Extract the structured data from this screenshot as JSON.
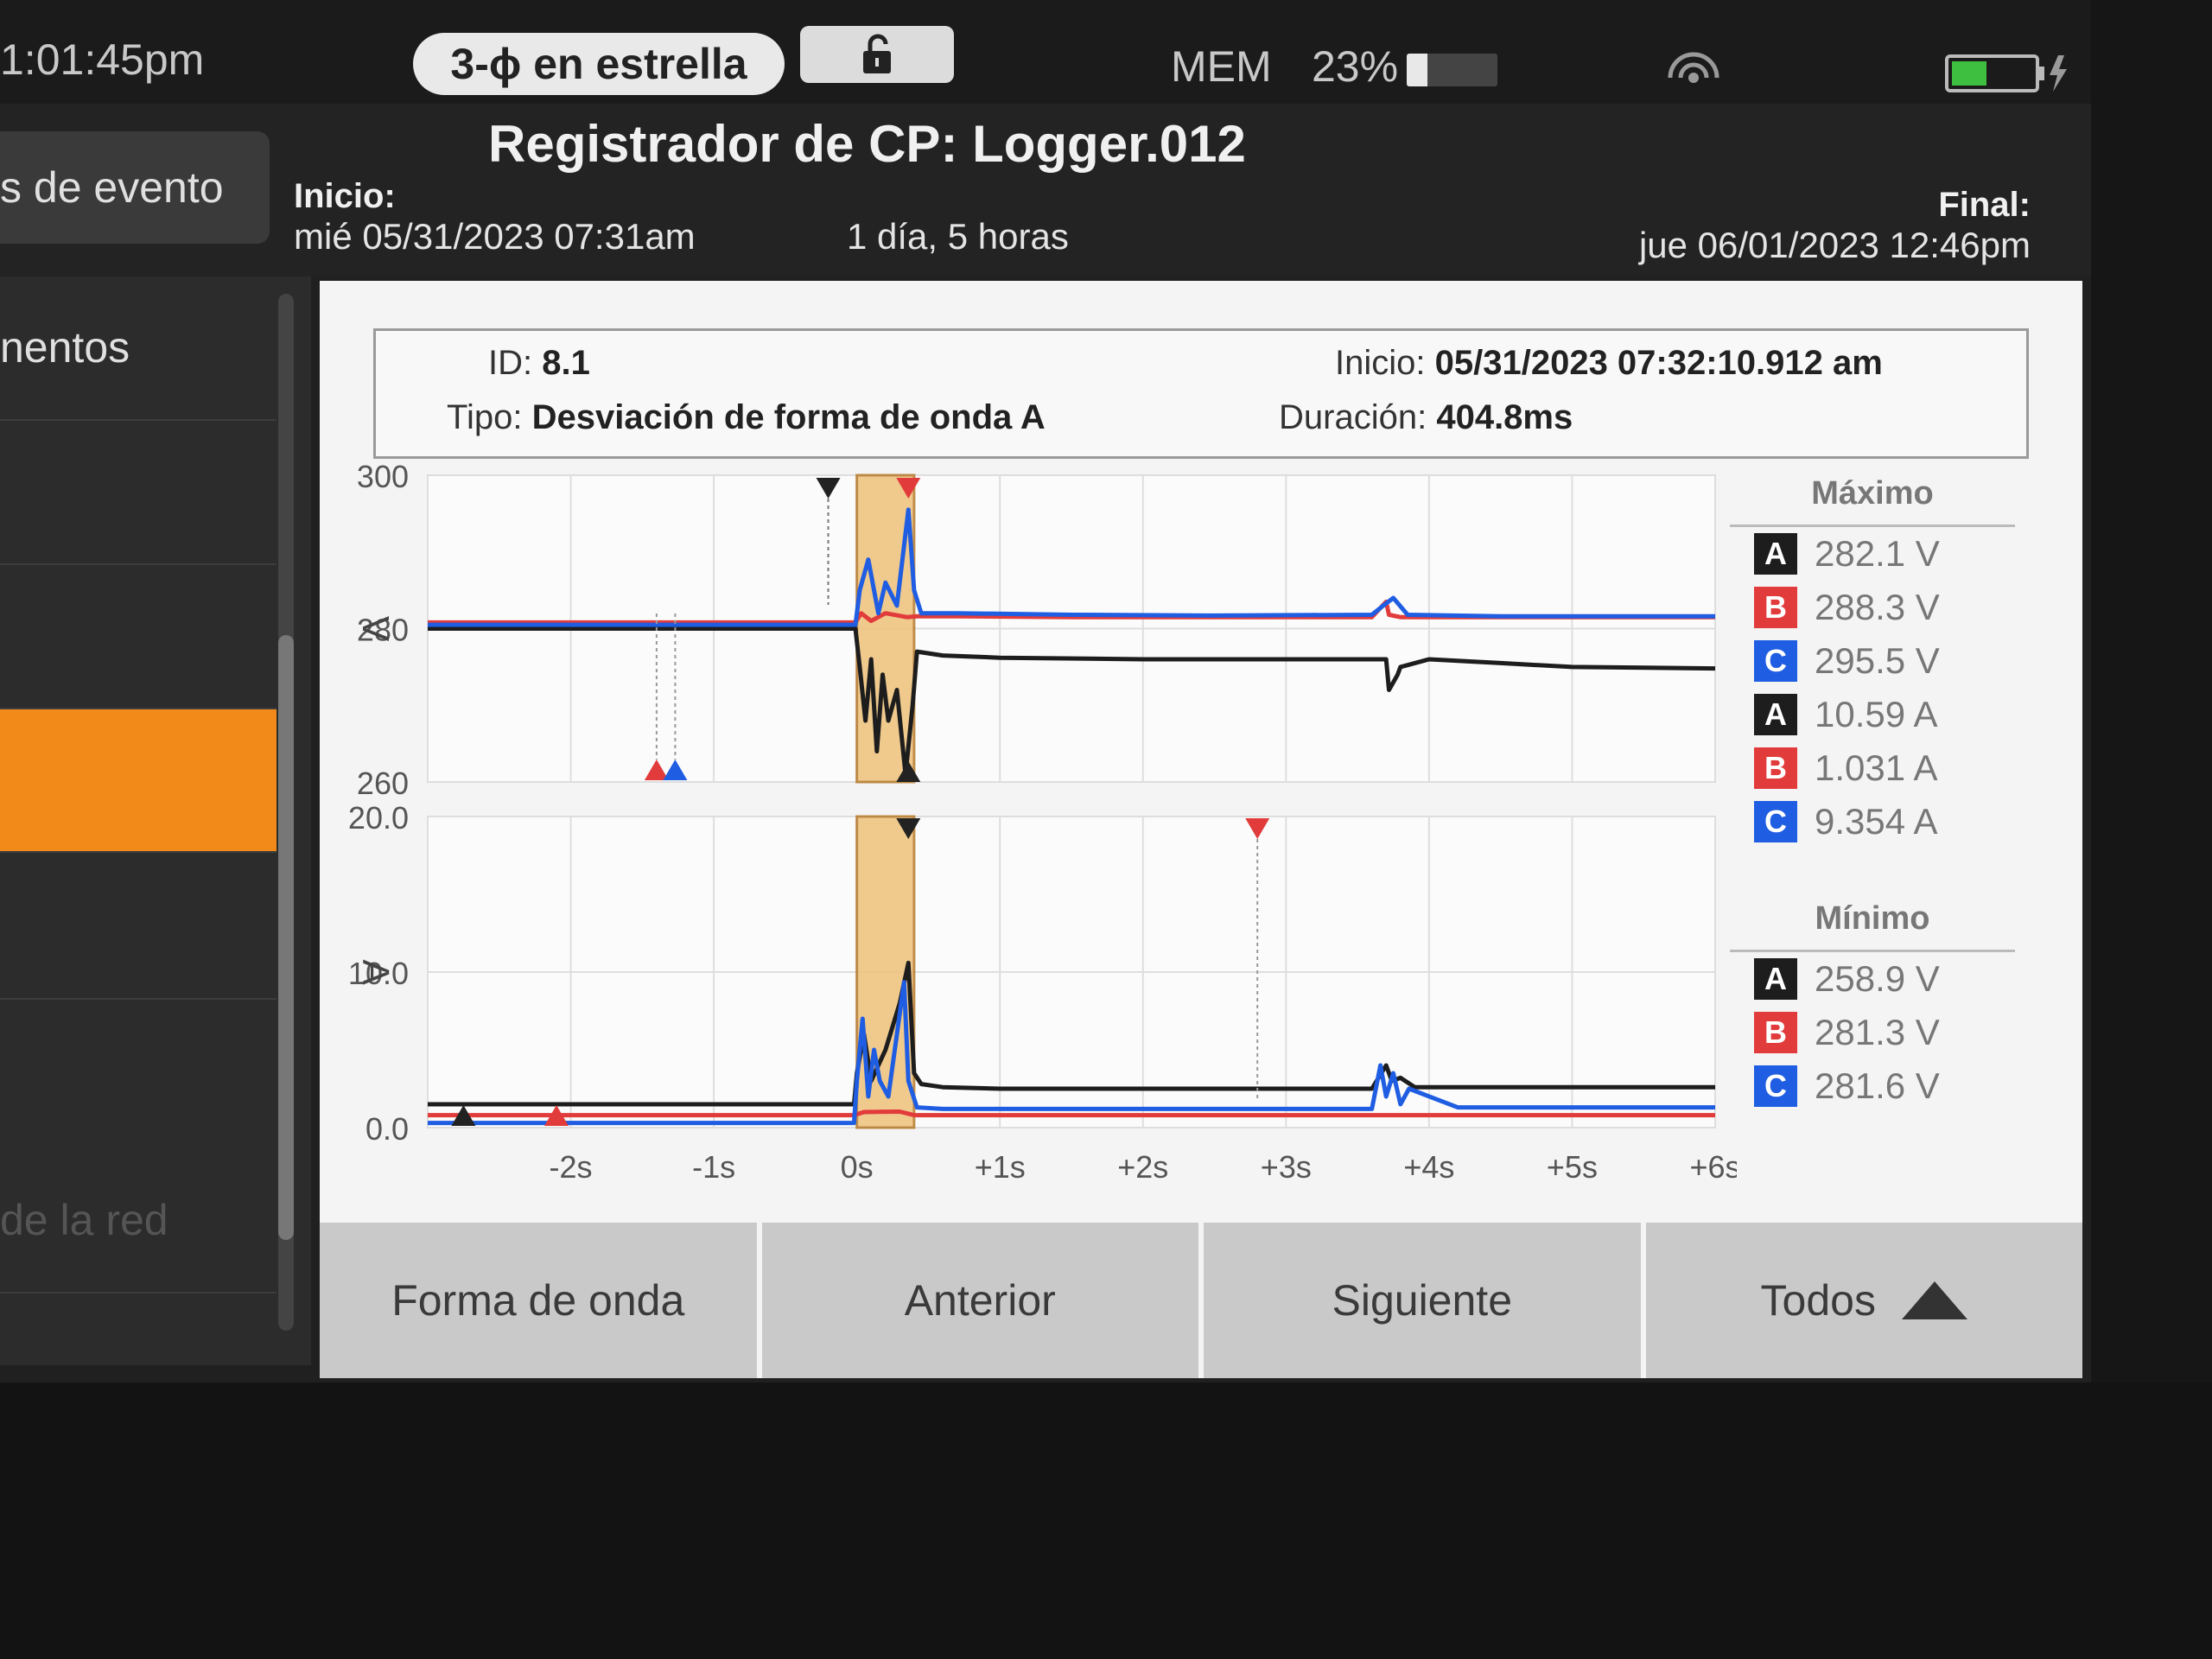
{
  "status": {
    "time": "1:01:45pm",
    "mode": "3-ϕ en estrella",
    "mem_label": "MEM",
    "mem_value": "23%",
    "mem_fraction": 0.23
  },
  "header": {
    "side_tab": "s de evento",
    "title": "Registrador de CP: Logger.012",
    "start_label": "Inicio:",
    "start_value": "mié 05/31/2023 07:31am",
    "duration": "1 día, 5 horas",
    "end_label": "Final:",
    "end_value": "jue 06/01/2023 12:46pm"
  },
  "menu": {
    "items": [
      {
        "label": "nentos"
      },
      {
        "label": ""
      },
      {
        "label": ""
      },
      {
        "label": ""
      },
      {
        "label": ""
      },
      {
        "label": "de la red"
      }
    ]
  },
  "event": {
    "id_label": "ID:",
    "id_value": "8.1",
    "type_label": "Tipo:",
    "type_value": "Desviación de forma de onda A",
    "start_label": "Inicio:",
    "start_value": "05/31/2023 07:32:10.912 am",
    "dur_label": "Duración:",
    "dur_value": "404.8ms"
  },
  "legend": {
    "max_title": "Máximo",
    "max": [
      {
        "phase": "A",
        "value": "282.1 V"
      },
      {
        "phase": "B",
        "value": "288.3 V"
      },
      {
        "phase": "C",
        "value": "295.5 V"
      },
      {
        "phase": "A",
        "value": "10.59 A"
      },
      {
        "phase": "B",
        "value": "1.031 A"
      },
      {
        "phase": "C",
        "value": "9.354 A"
      }
    ],
    "min_title": "Mínimo",
    "min": [
      {
        "phase": "A",
        "value": "258.9 V"
      },
      {
        "phase": "B",
        "value": "281.3 V"
      },
      {
        "phase": "C",
        "value": "281.6 V"
      }
    ]
  },
  "buttons": {
    "waveform": "Forma de onda",
    "prev": "Anterior",
    "next": "Siguiente",
    "all": "Todos"
  },
  "colors": {
    "A": "#1d1d1d",
    "B": "#e23b3b",
    "C": "#1f5de2",
    "event": "#efc27a",
    "active": "#f28a1a"
  },
  "chart_data": [
    {
      "type": "line",
      "ylabel": "V",
      "ylim": [
        260,
        300
      ],
      "yticks": [
        "300",
        "280",
        "260"
      ],
      "xlim": [
        -3,
        6
      ],
      "xticks": [
        "-2s",
        "-1s",
        "0s",
        "+1s",
        "+2s",
        "+3s",
        "+4s",
        "+5s",
        "+6s"
      ],
      "event_window": [
        0,
        0.4
      ],
      "series": [
        {
          "name": "A",
          "x": [
            -3,
            -0.01,
            0.02,
            0.06,
            0.1,
            0.14,
            0.18,
            0.22,
            0.28,
            0.34,
            0.39,
            0.42,
            0.6,
            1,
            2,
            3.5,
            3.7,
            3.72,
            3.78,
            3.8,
            4,
            4.5,
            5,
            6
          ],
          "y": [
            280,
            280,
            275,
            268,
            276,
            264,
            274,
            268,
            272,
            261,
            270,
            277,
            276.5,
            276.2,
            276,
            276,
            276,
            272,
            274,
            275,
            276,
            275.5,
            275,
            274.8
          ]
        },
        {
          "name": "B",
          "x": [
            -3,
            -0.01,
            0.03,
            0.1,
            0.2,
            0.35,
            0.42,
            0.7,
            1.5,
            2.5,
            3.6,
            3.7,
            3.72,
            3.8,
            4.2,
            5,
            6
          ],
          "y": [
            280.8,
            280.8,
            282,
            281,
            282,
            281.5,
            281.6,
            281.6,
            281.5,
            281.5,
            281.5,
            283.5,
            281.8,
            281.5,
            281.5,
            281.5,
            281.5
          ]
        },
        {
          "name": "C",
          "x": [
            -3,
            -0.01,
            0.02,
            0.08,
            0.15,
            0.2,
            0.28,
            0.36,
            0.4,
            0.45,
            0.7,
            1.5,
            2.5,
            3.6,
            3.68,
            3.75,
            3.85,
            4.5,
            5.5,
            6
          ],
          "y": [
            280.5,
            280.5,
            285,
            289,
            282,
            286,
            283,
            295.5,
            285,
            282,
            282,
            281.8,
            281.7,
            281.8,
            283,
            284,
            281.8,
            281.6,
            281.6,
            281.6
          ]
        }
      ]
    },
    {
      "type": "line",
      "ylabel": "A",
      "ylim": [
        0,
        20
      ],
      "yticks": [
        "20.0",
        "10.0",
        "0.0"
      ],
      "xlim": [
        -3,
        6
      ],
      "xticks": [
        "-2s",
        "-1s",
        "0s",
        "+1s",
        "+2s",
        "+3s",
        "+4s",
        "+5s",
        "+6s"
      ],
      "event_window": [
        0,
        0.4
      ],
      "series": [
        {
          "name": "A",
          "x": [
            -3,
            -0.02,
            0,
            0.05,
            0.1,
            0.15,
            0.2,
            0.3,
            0.36,
            0.4,
            0.45,
            0.6,
            1,
            3.6,
            3.7,
            3.74,
            3.8,
            3.9,
            4.5,
            6
          ],
          "y": [
            1.5,
            1.5,
            3.5,
            6,
            3,
            4,
            5,
            8,
            10.59,
            3.5,
            2.8,
            2.6,
            2.5,
            2.5,
            4,
            3,
            3.2,
            2.6,
            2.6,
            2.6
          ]
        },
        {
          "name": "B",
          "x": [
            -3,
            -0.02,
            0.05,
            0.3,
            0.4,
            6
          ],
          "y": [
            0.8,
            0.8,
            1,
            1.03,
            0.8,
            0.8
          ]
        },
        {
          "name": "C",
          "x": [
            -3,
            -0.02,
            0,
            0.04,
            0.08,
            0.12,
            0.16,
            0.22,
            0.28,
            0.33,
            0.36,
            0.42,
            0.6,
            2,
            3.6,
            3.66,
            3.7,
            3.75,
            3.8,
            3.86,
            4.2,
            6
          ],
          "y": [
            0.3,
            0.3,
            3,
            7,
            2,
            5,
            3,
            2,
            6,
            9.354,
            3,
            1.3,
            1.2,
            1.2,
            1.2,
            4,
            2,
            3.5,
            1.5,
            2.5,
            1.3,
            1.3
          ]
        }
      ]
    }
  ]
}
